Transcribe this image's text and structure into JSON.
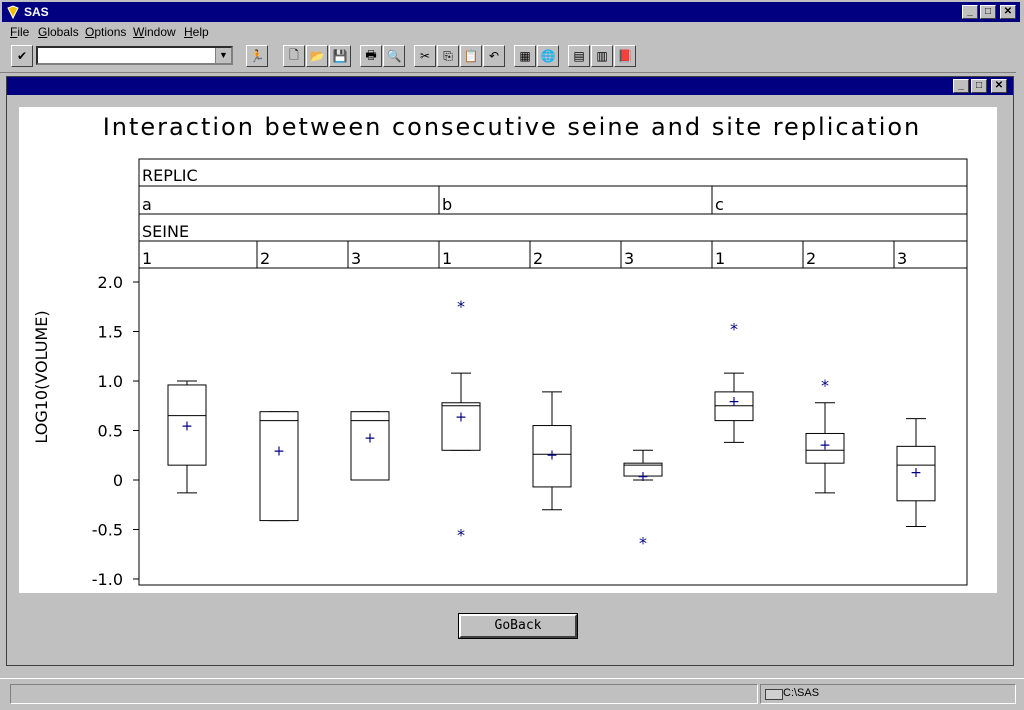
{
  "app": {
    "title": "SAS"
  },
  "menu": [
    "File",
    "Globals",
    "Options",
    "Window",
    "Help"
  ],
  "toolbar": {
    "command_value": ""
  },
  "chart_data": {
    "type": "box",
    "title": "Interaction between consecutive seine and site replication",
    "ylabel": "LOG10(VOLUME)",
    "ylim": [
      -1.0,
      2.0
    ],
    "yticks": [
      "2.0",
      "1.5",
      "1.0",
      "0.5",
      "0",
      "-0.5",
      "-1.0"
    ],
    "header_group_label": "REPLIC",
    "header_sub_label": "SEINE",
    "groups": [
      "a",
      "b",
      "c"
    ],
    "seine_levels": [
      "1",
      "2",
      "3",
      "1",
      "2",
      "3",
      "1",
      "2",
      "3"
    ],
    "boxes": [
      {
        "group": "a",
        "seine": "1",
        "min": -0.13,
        "q1": 0.15,
        "median": 0.65,
        "q3": 0.96,
        "max": 1.0,
        "mean": 0.55,
        "outliers": []
      },
      {
        "group": "a",
        "seine": "2",
        "min": -0.41,
        "q1": -0.41,
        "median": 0.6,
        "q3": 0.69,
        "max": 0.69,
        "mean": 0.3,
        "outliers": []
      },
      {
        "group": "a",
        "seine": "3",
        "min": 0.0,
        "q1": 0.0,
        "median": 0.6,
        "q3": 0.69,
        "max": 0.69,
        "mean": 0.43,
        "outliers": []
      },
      {
        "group": "b",
        "seine": "1",
        "min": 0.3,
        "q1": 0.3,
        "median": 0.75,
        "q3": 0.78,
        "max": 1.08,
        "mean": 0.64,
        "outliers": [
          1.79,
          -0.52
        ]
      },
      {
        "group": "b",
        "seine": "2",
        "min": -0.3,
        "q1": -0.07,
        "median": 0.26,
        "q3": 0.55,
        "max": 0.89,
        "mean": 0.26,
        "outliers": []
      },
      {
        "group": "b",
        "seine": "3",
        "min": 0.0,
        "q1": 0.04,
        "median": 0.15,
        "q3": 0.17,
        "max": 0.3,
        "mean": 0.04,
        "outliers": [
          -0.6
        ]
      },
      {
        "group": "c",
        "seine": "1",
        "min": 0.38,
        "q1": 0.6,
        "median": 0.75,
        "q3": 0.89,
        "max": 1.08,
        "mean": 0.8,
        "outliers": [
          1.56
        ]
      },
      {
        "group": "c",
        "seine": "2",
        "min": -0.13,
        "q1": 0.17,
        "median": 0.3,
        "q3": 0.47,
        "max": 0.78,
        "mean": 0.36,
        "outliers": [
          0.99
        ]
      },
      {
        "group": "c",
        "seine": "3",
        "min": -0.47,
        "q1": -0.21,
        "median": 0.15,
        "q3": 0.34,
        "max": 0.62,
        "mean": 0.08,
        "outliers": []
      }
    ],
    "colors": {
      "mean_marker": "#000080",
      "outlier_marker": "#000080",
      "box": "#000000"
    }
  },
  "button": {
    "goback": "GoBack"
  },
  "status": {
    "path": "C:\\SAS"
  }
}
